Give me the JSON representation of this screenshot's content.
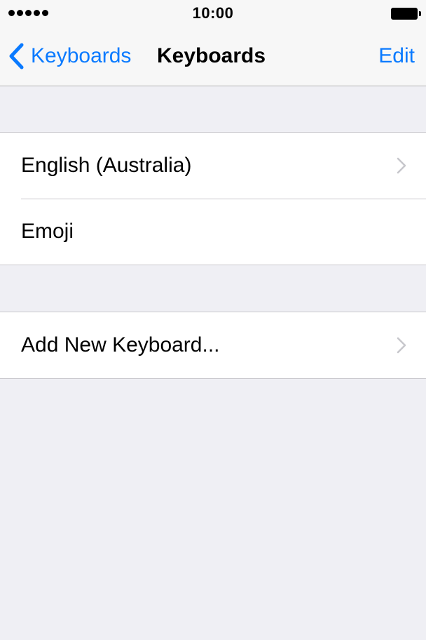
{
  "status_bar": {
    "time": "10:00",
    "signal_dots": 5,
    "battery": "full"
  },
  "nav": {
    "back_label": "Keyboards",
    "title": "Keyboards",
    "edit_label": "Edit"
  },
  "keyboards": [
    {
      "label": "English (Australia)",
      "chevron": true
    },
    {
      "label": "Emoji",
      "chevron": false
    }
  ],
  "add_keyboard": {
    "label": "Add New Keyboard...",
    "chevron": true
  },
  "colors": {
    "accent": "#0a7aff",
    "background": "#efeff4",
    "separator": "#c8c7cc",
    "chevron": "#c7c7cc"
  }
}
